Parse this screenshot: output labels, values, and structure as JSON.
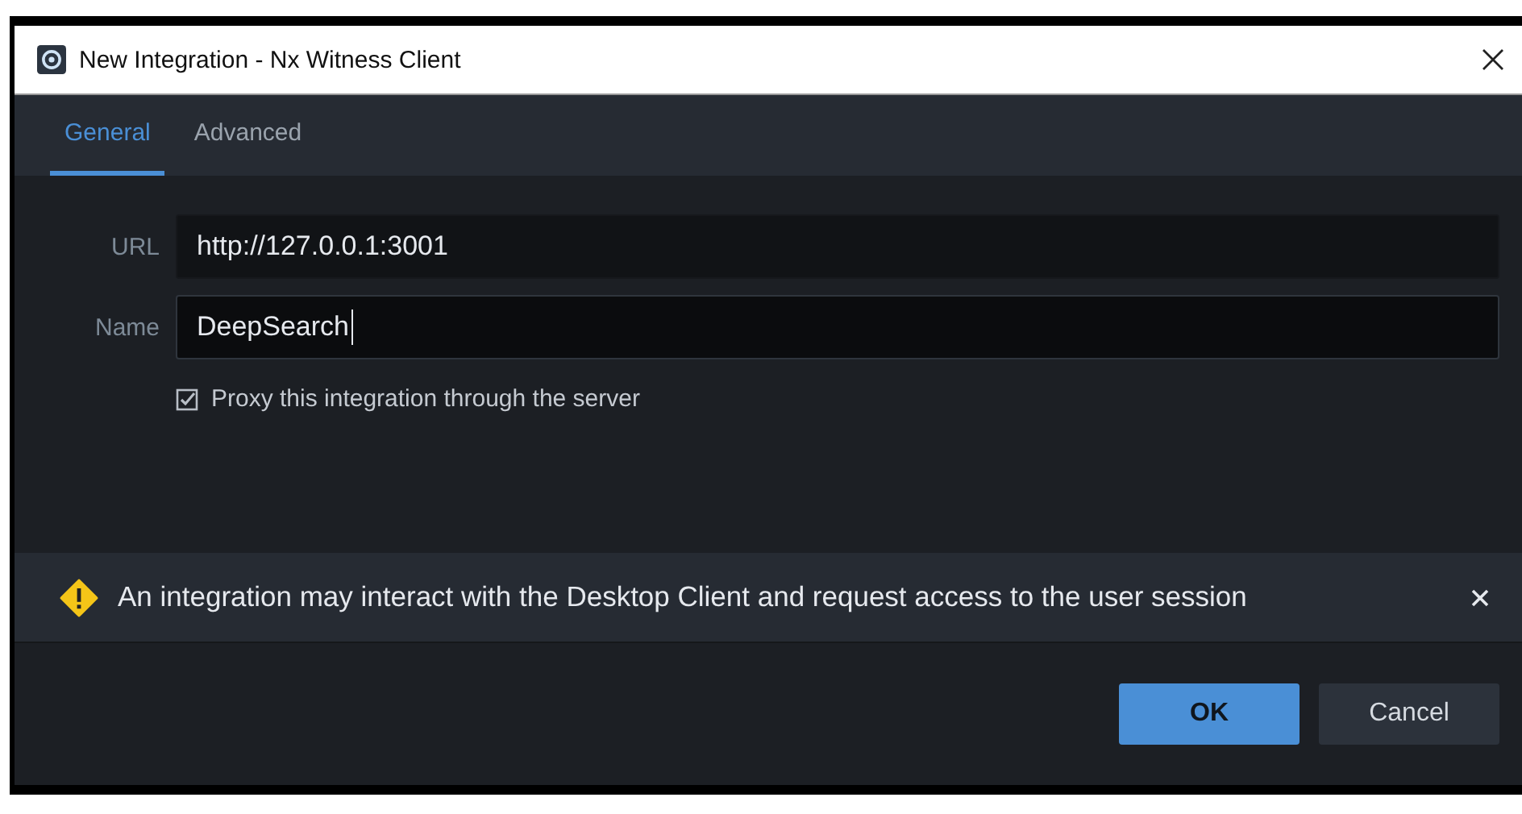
{
  "window": {
    "title": "New Integration - Nx Witness Client"
  },
  "tabs": [
    {
      "label": "General",
      "selected": true
    },
    {
      "label": "Advanced",
      "selected": false
    }
  ],
  "fields": [
    {
      "label": "URL",
      "value": "http://127.0.0.1:3001",
      "focused": false
    },
    {
      "label": "Name",
      "value": "DeepSearch",
      "focused": true
    }
  ],
  "proxy": {
    "label": "Proxy this integration through the server",
    "checked": true
  },
  "banner": {
    "text": "An integration may interact with the Desktop Client and request access to the user session"
  },
  "buttons": [
    {
      "label": "OK",
      "kind": "primary"
    },
    {
      "label": "Cancel",
      "kind": "secondary"
    }
  ]
}
